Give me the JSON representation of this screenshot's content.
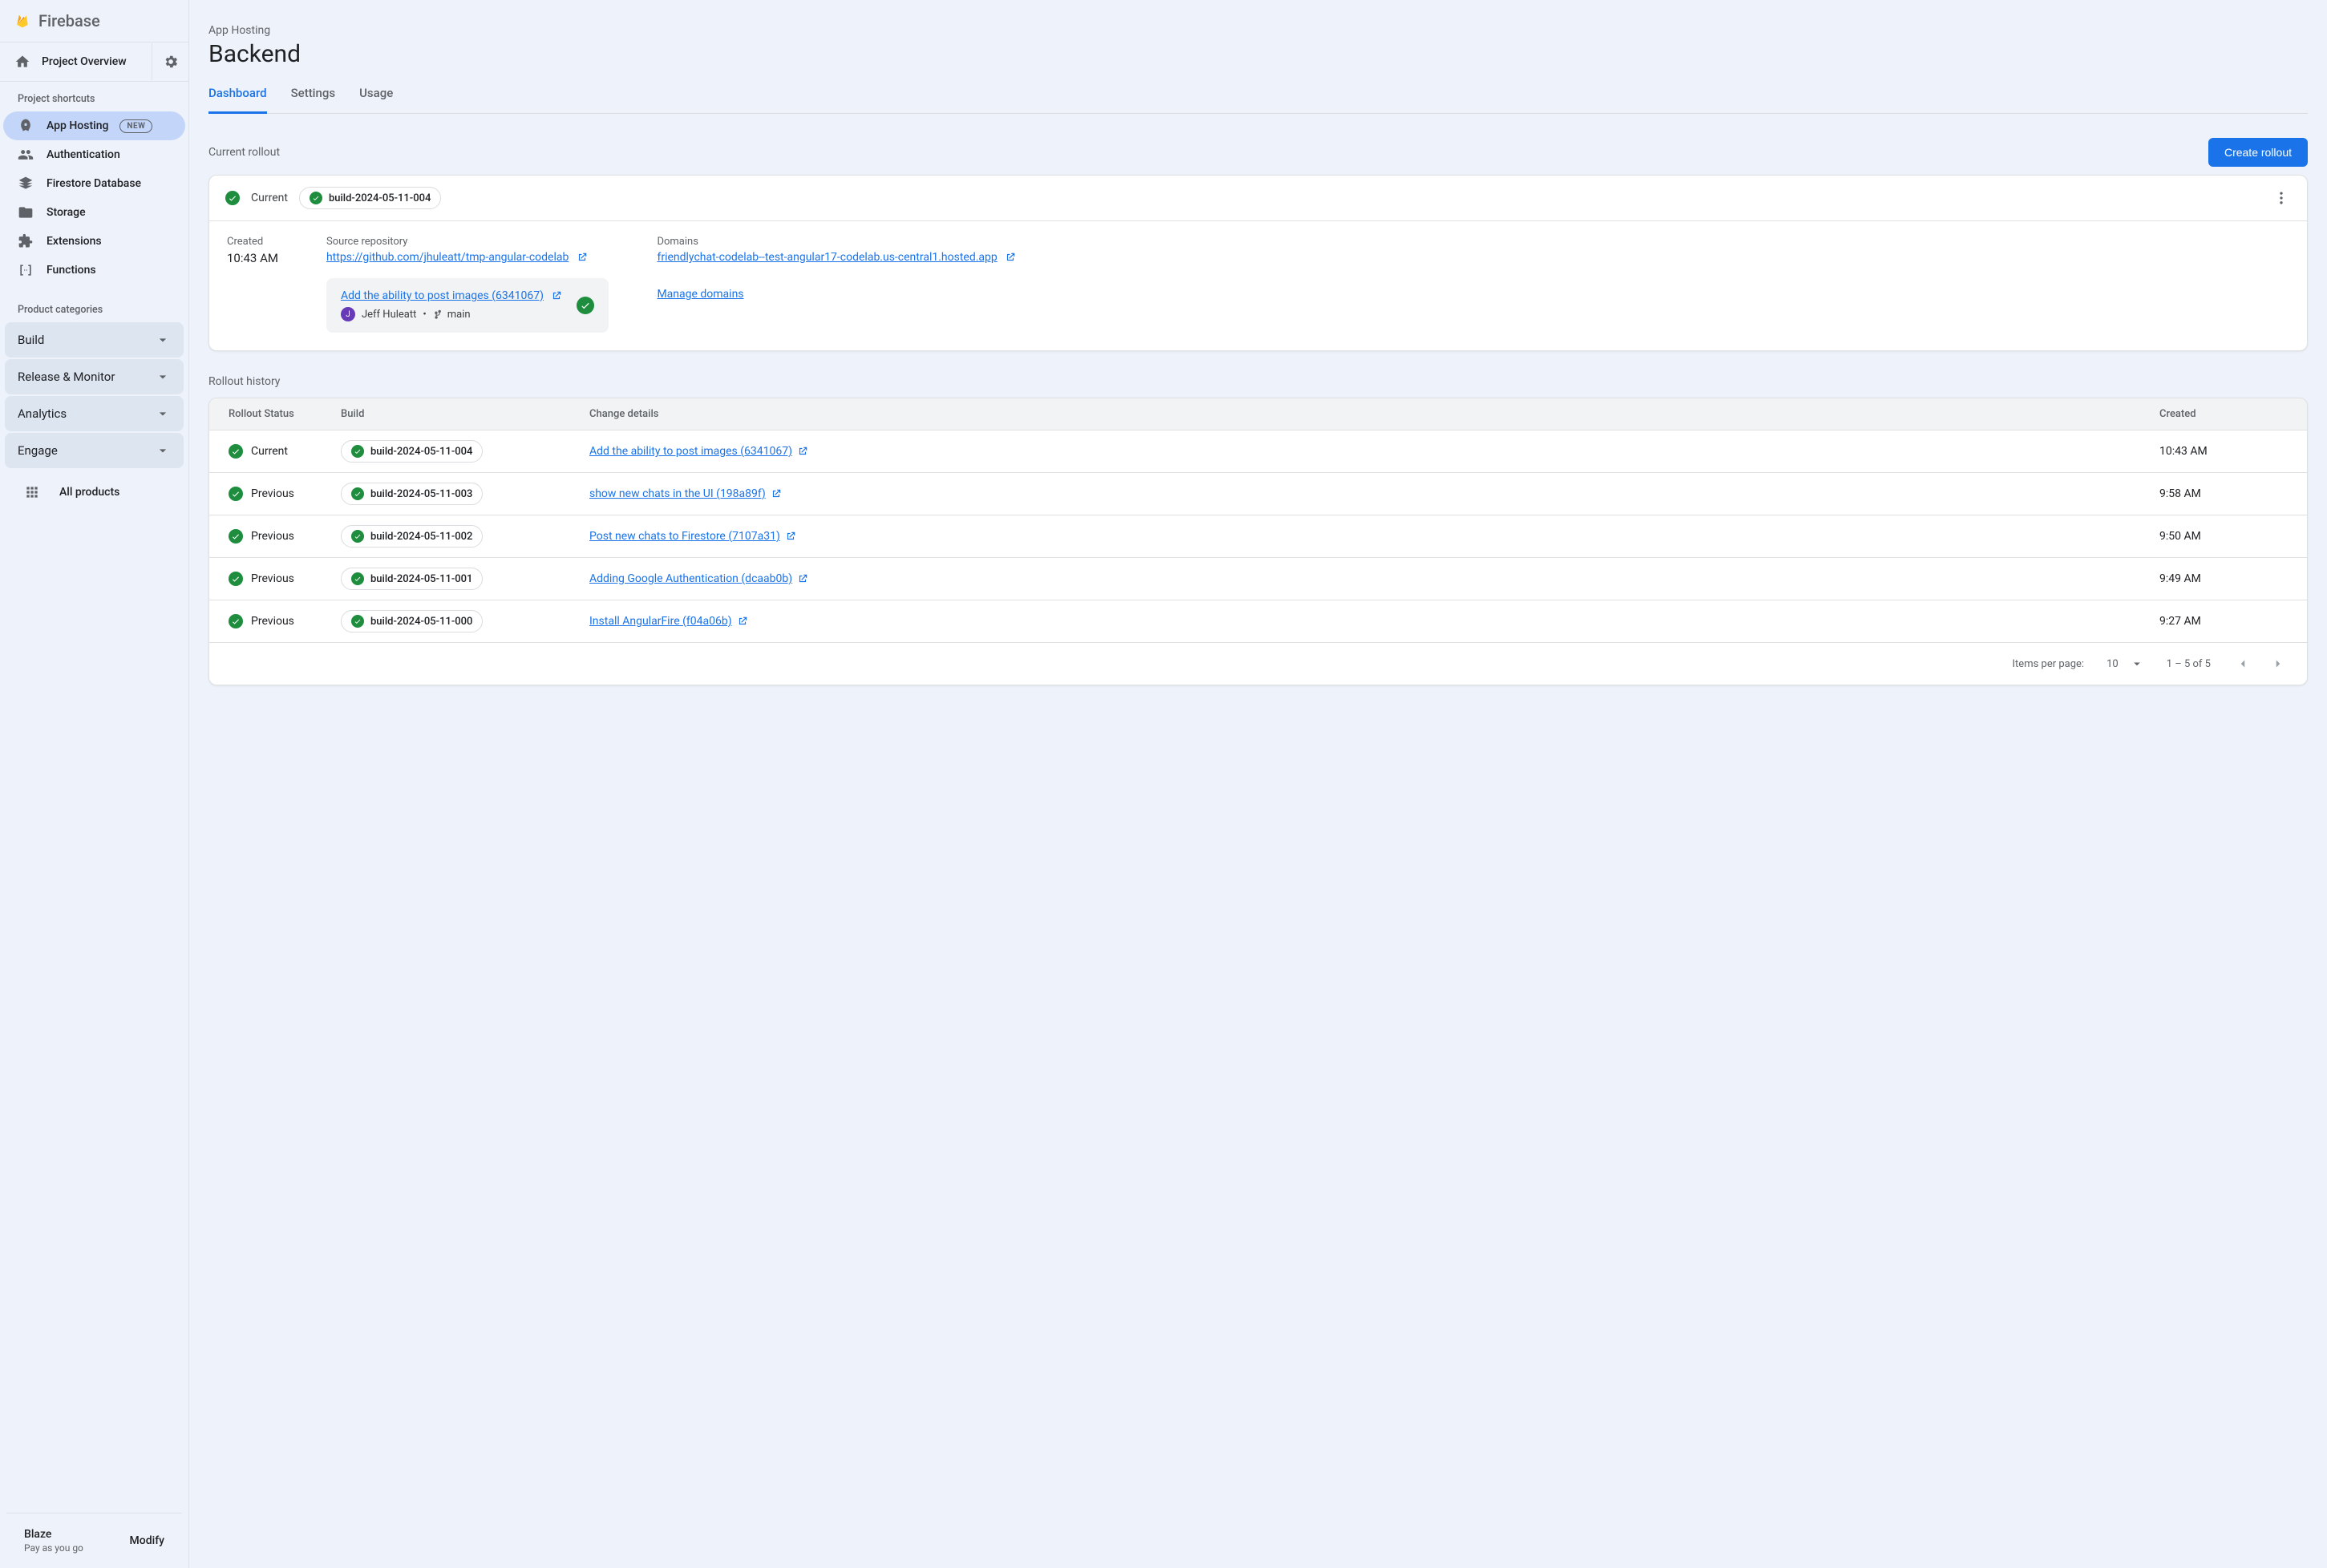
{
  "brand": "Firebase",
  "overview_label": "Project Overview",
  "shortcuts_label": "Project shortcuts",
  "nav": [
    {
      "label": "App Hosting",
      "badge": "NEW",
      "icon": "rocket",
      "active": true
    },
    {
      "label": "Authentication",
      "icon": "people"
    },
    {
      "label": "Firestore Database",
      "icon": "layers"
    },
    {
      "label": "Storage",
      "icon": "folder"
    },
    {
      "label": "Extensions",
      "icon": "extension"
    },
    {
      "label": "Functions",
      "icon": "brackets"
    }
  ],
  "categories_label": "Product categories",
  "categories": [
    {
      "label": "Build"
    },
    {
      "label": "Release & Monitor"
    },
    {
      "label": "Analytics"
    },
    {
      "label": "Engage"
    }
  ],
  "all_products_label": "All products",
  "plan": {
    "name": "Blaze",
    "sub": "Pay as you go",
    "modify": "Modify"
  },
  "breadcrumb": "App Hosting",
  "page_title": "Backend",
  "tabs": [
    {
      "label": "Dashboard",
      "active": true
    },
    {
      "label": "Settings"
    },
    {
      "label": "Usage"
    }
  ],
  "current_rollout_label": "Current rollout",
  "create_button": "Create rollout",
  "rollout_card": {
    "status": "Current",
    "build": "build-2024-05-11-004",
    "created_label": "Created",
    "created_value": "10:43 AM",
    "repo_label": "Source repository",
    "repo_url": "https://github.com/jhuleatt/tmp-angular-codelab",
    "domain_label": "Domains",
    "domain_value": "friendlychat-codelab--test-angular17-codelab.us-central1.hosted.app",
    "commit_title": "Add the ability to post images (6341067)",
    "commit_author": "Jeff Huleatt",
    "commit_branch": "main",
    "manage_domains": "Manage domains"
  },
  "history_label": "Rollout history",
  "columns": {
    "status": "Rollout Status",
    "build": "Build",
    "change": "Change details",
    "created": "Created"
  },
  "rows": [
    {
      "status": "Current",
      "build": "build-2024-05-11-004",
      "change": "Add the ability to post images (6341067)",
      "created": "10:43 AM"
    },
    {
      "status": "Previous",
      "build": "build-2024-05-11-003",
      "change": "show new chats in the UI (198a89f)",
      "created": "9:58 AM"
    },
    {
      "status": "Previous",
      "build": "build-2024-05-11-002",
      "change": "Post new chats to Firestore (7107a31)",
      "created": "9:50 AM"
    },
    {
      "status": "Previous",
      "build": "build-2024-05-11-001",
      "change": "Adding Google Authentication (dcaab0b)",
      "created": "9:49 AM"
    },
    {
      "status": "Previous",
      "build": "build-2024-05-11-000",
      "change": "Install AngularFire (f04a06b)",
      "created": "9:27 AM"
    }
  ],
  "pager": {
    "items_label": "Items per page:",
    "page_size": "10",
    "range": "1 – 5 of 5"
  }
}
